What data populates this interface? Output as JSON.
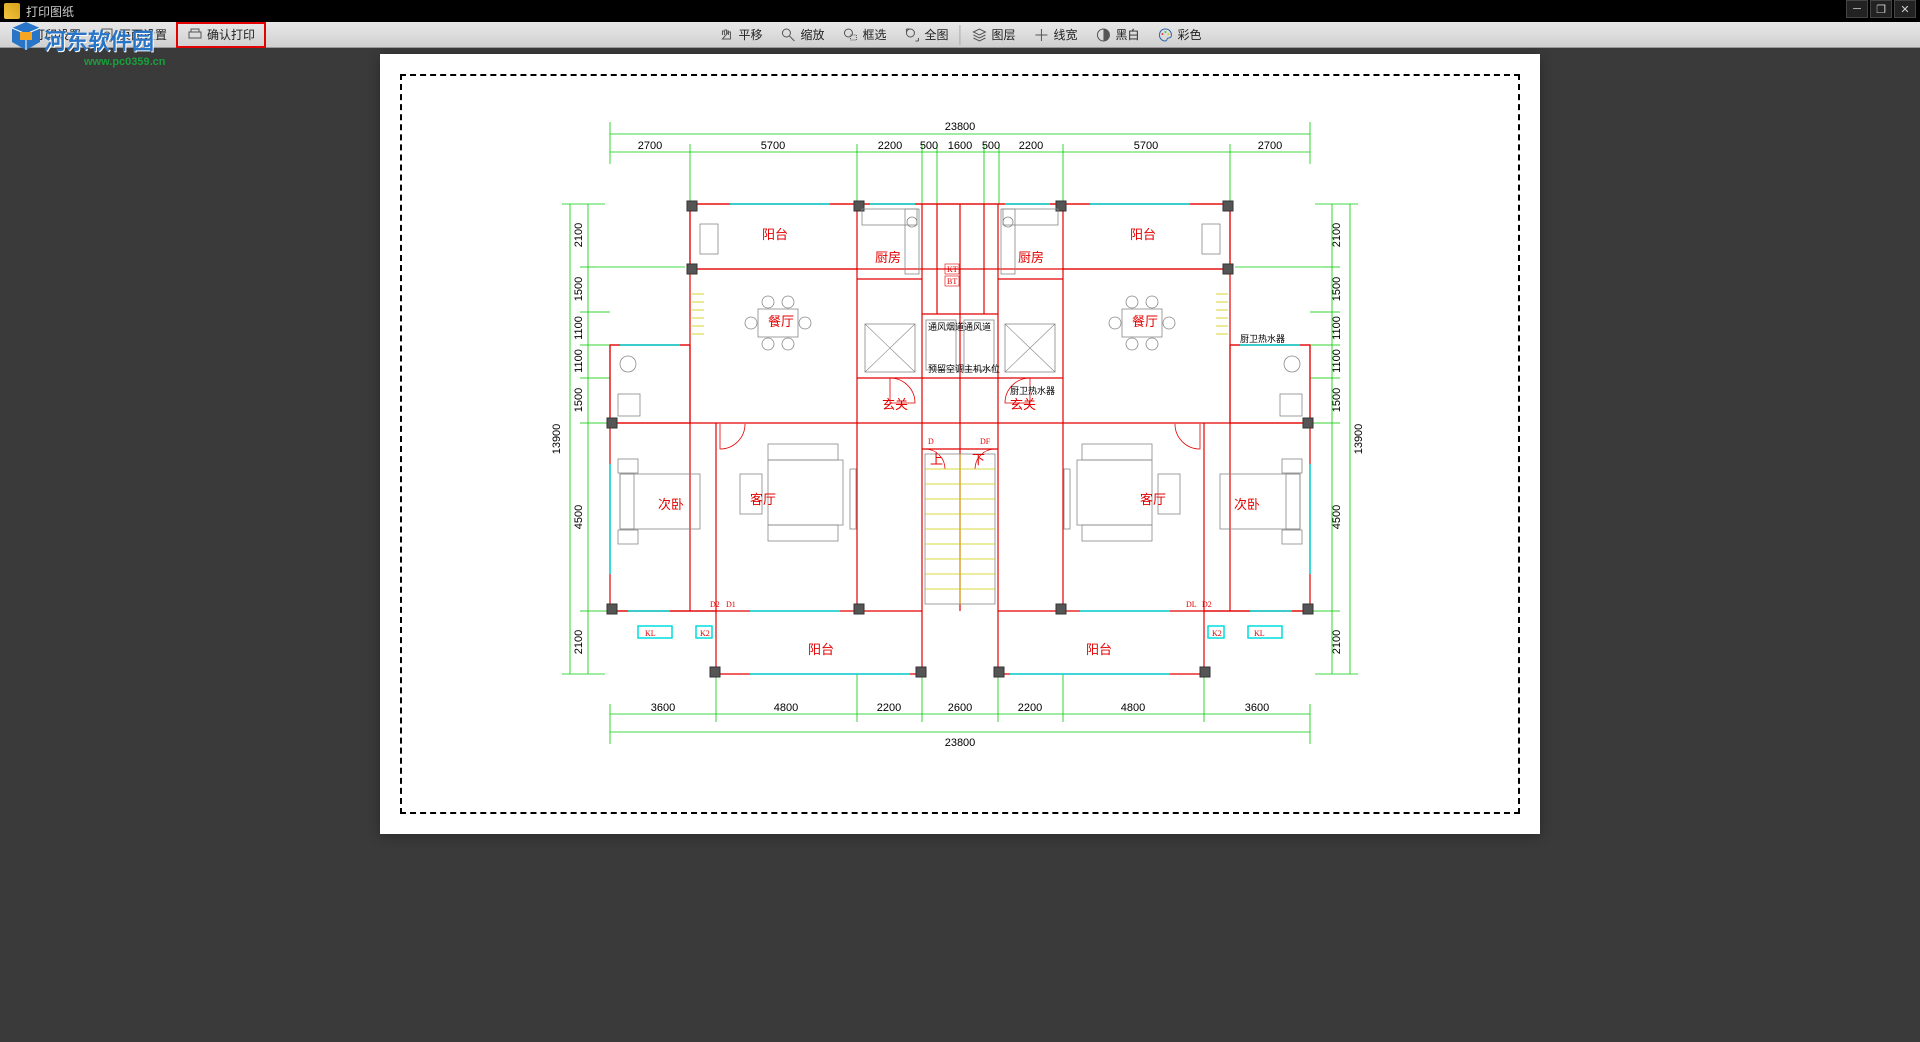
{
  "window": {
    "title": "打印图纸"
  },
  "toolbar_left": {
    "print_settings": "打印设置",
    "page_settings": "页面设置",
    "confirm_print": "确认打印"
  },
  "toolbar_center": {
    "pan": "平移",
    "zoom": "缩放",
    "box_select": "框选",
    "full_view": "全图",
    "layers": "图层",
    "line_width": "线宽",
    "bw": "黑白",
    "color": "彩色"
  },
  "watermark": {
    "site_name": "河东软件园",
    "url": "www.pc0359.cn"
  },
  "plan": {
    "total_width": "23800",
    "total_height": "13900",
    "top_dims": [
      "2700",
      "5700",
      "2200",
      "500",
      "1600",
      "500",
      "2200",
      "5700",
      "2700"
    ],
    "bottom_dims": [
      "3600",
      "4800",
      "2200",
      "2600",
      "2200",
      "4800",
      "3600"
    ],
    "left_dims_outer": [
      "2100",
      "1500",
      "1100",
      "1100",
      "1500",
      "4500",
      "2100"
    ],
    "right_dims_outer": [
      "2100",
      "1500",
      "1100",
      "1100",
      "1500",
      "4500",
      "2100"
    ],
    "rooms": {
      "balcony": "阳台",
      "kitchen": "厨房",
      "dining": "餐厅",
      "entrance": "玄关",
      "living": "客厅",
      "bedroom2": "次卧",
      "up": "上",
      "down": "下"
    },
    "labels": {
      "kt": "KT",
      "bt": "BT",
      "d": "D",
      "df": "DF",
      "d1": "D1",
      "d2": "D2",
      "dl": "DL",
      "kl": "KL",
      "k2": "K2"
    },
    "notes": {
      "note1": "通风烟道通风道",
      "note2": "预留空调主机水位",
      "note3": "厨卫热水器"
    }
  }
}
